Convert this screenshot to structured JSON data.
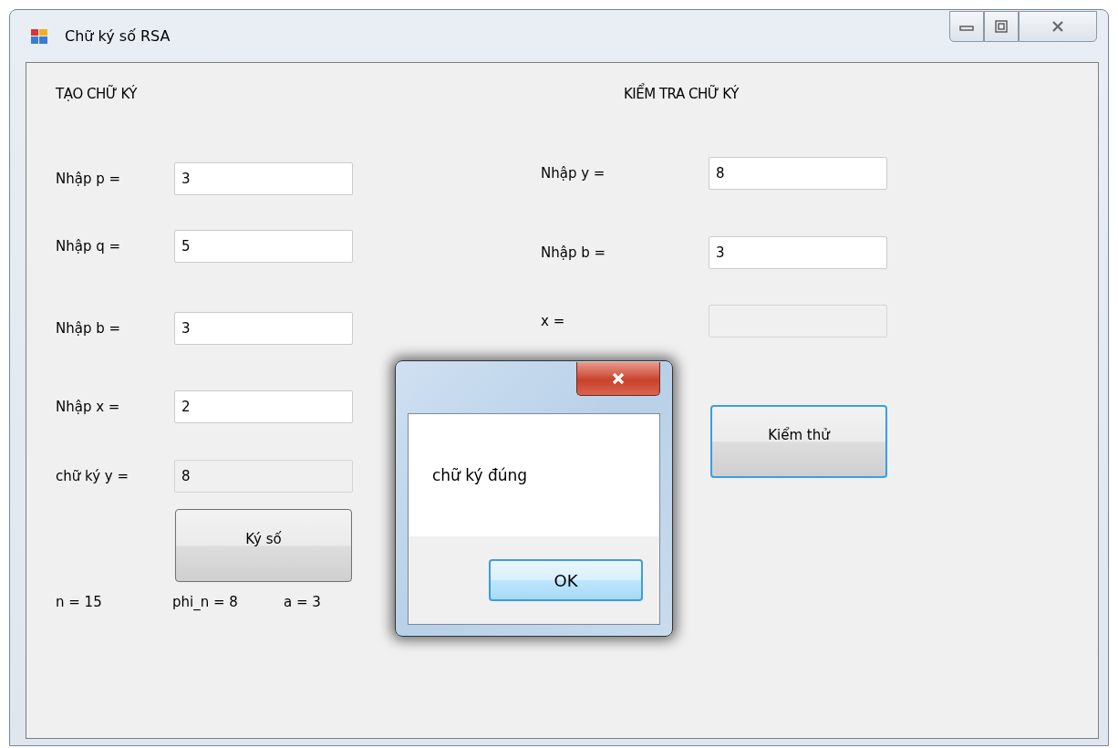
{
  "window": {
    "title": "Chữ ký số RSA"
  },
  "create_panel": {
    "heading": "TẠO CHỮ KÝ",
    "fields": [
      {
        "label": "Nhập p =",
        "value": "3",
        "readonly": false
      },
      {
        "label": "Nhập q =",
        "value": "5",
        "readonly": false
      },
      {
        "label": "Nhập b =",
        "value": "3",
        "readonly": false
      },
      {
        "label": "Nhập x =",
        "value": "2",
        "readonly": false
      },
      {
        "label": "chữ ký y =",
        "value": "8",
        "readonly": true
      }
    ],
    "button": "Ký số",
    "results": [
      "n = 15",
      "phi_n = 8",
      "a = 3"
    ]
  },
  "verify_panel": {
    "heading": "KIỂM TRA CHỮ KÝ",
    "fields": [
      {
        "label": "Nhập y =",
        "value": "8",
        "readonly": false
      },
      {
        "label": "Nhập b =",
        "value": "3",
        "readonly": false
      },
      {
        "label": "x =",
        "readonly": true
      }
    ],
    "button": "Kiểm thử"
  },
  "message_box": {
    "message": "chữ ký đúng",
    "button": "OK"
  }
}
